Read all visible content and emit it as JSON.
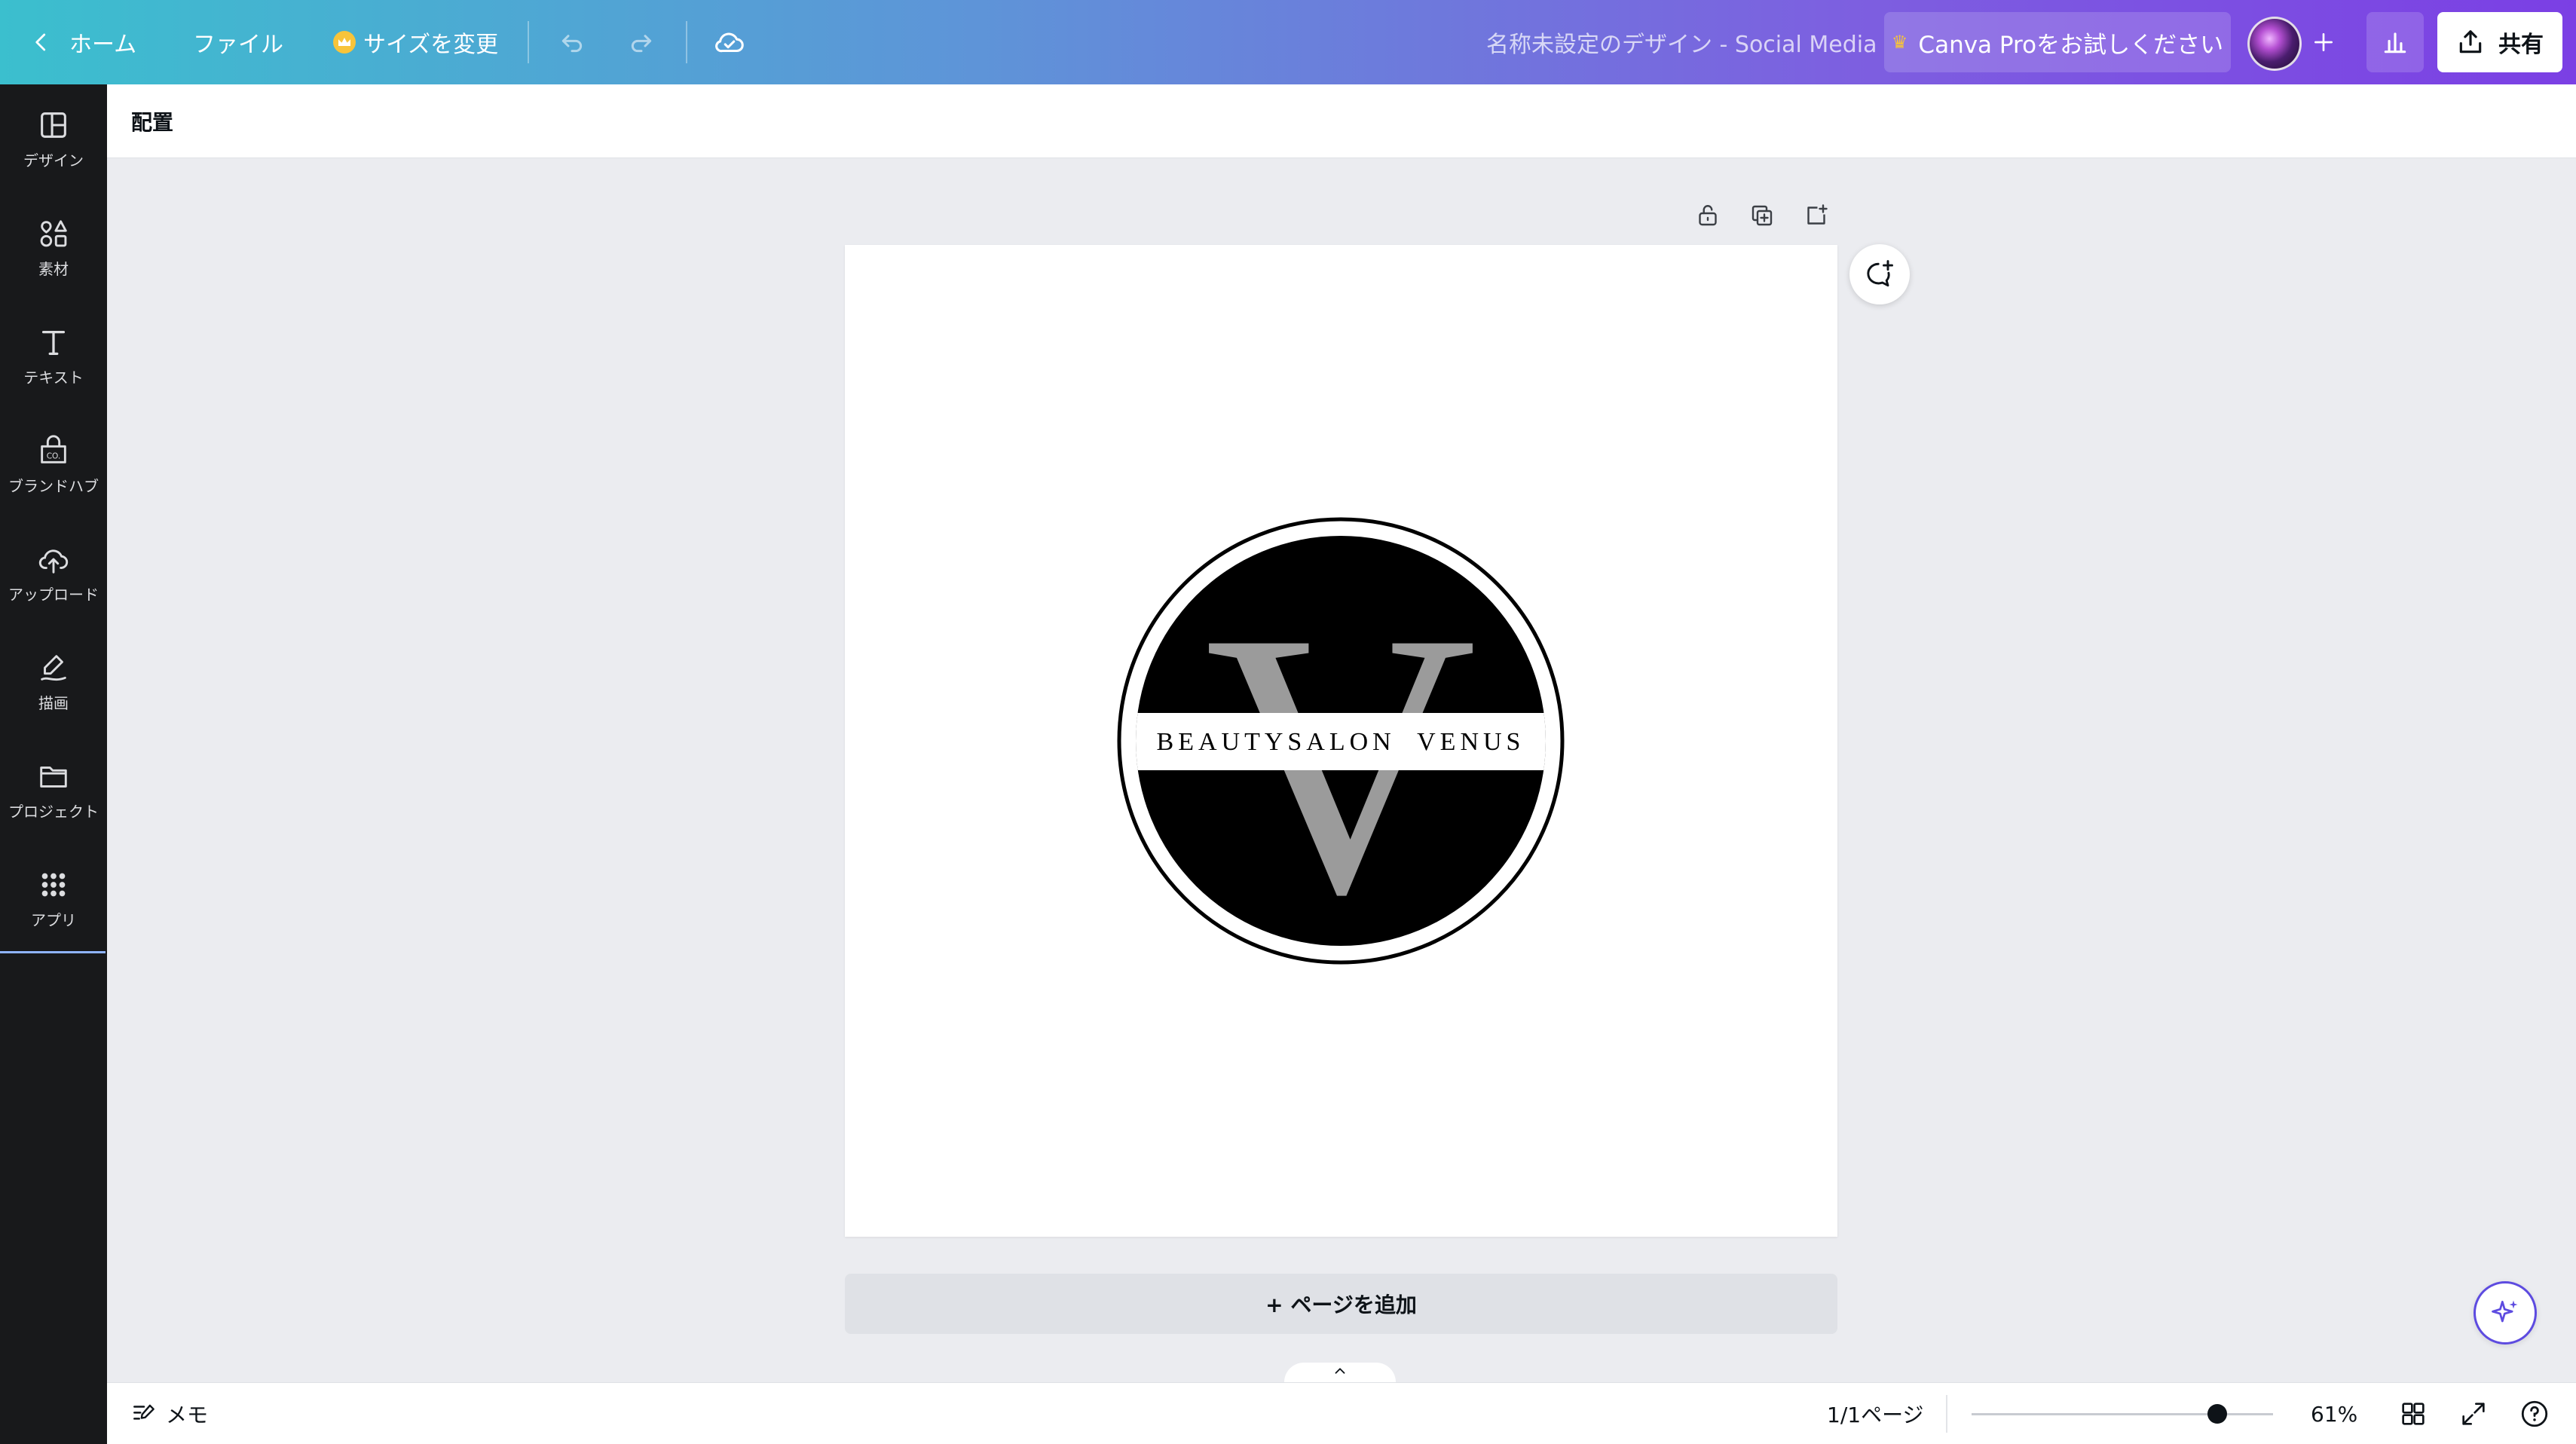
{
  "topbar": {
    "home_label": "ホーム",
    "file_label": "ファイル",
    "resize_label": "サイズを変更",
    "doc_title": "名称未設定のデザイン - Social Media",
    "pro_label": "Canva Proをお試しください",
    "share_label": "共有"
  },
  "sidebar": {
    "items": [
      {
        "label": "デザイン",
        "icon": "layout-icon"
      },
      {
        "label": "素材",
        "icon": "elements-icon"
      },
      {
        "label": "テキスト",
        "icon": "text-icon"
      },
      {
        "label": "ブランドハブ",
        "icon": "brand-hub-icon"
      },
      {
        "label": "アップロード",
        "icon": "upload-icon"
      },
      {
        "label": "描画",
        "icon": "draw-icon"
      },
      {
        "label": "プロジェクト",
        "icon": "folder-icon"
      },
      {
        "label": "アプリ",
        "icon": "apps-icon"
      }
    ]
  },
  "context_toolbar": {
    "position_label": "配置"
  },
  "canvas": {
    "logo": {
      "monogram": "V",
      "text": "BEAUTYSALON  VENUS"
    },
    "add_page_label": "+ ページを追加"
  },
  "bottombar": {
    "notes_label": "メモ",
    "page_indicator": "1/1ページ",
    "zoom_label": "61%",
    "zoom_value": 61
  },
  "colors": {
    "gradient_start": "#3bbfce",
    "gradient_end": "#7b3fe4",
    "sidebar_bg": "#18191b",
    "canvas_bg": "#ebecf0",
    "logo_black": "#000000",
    "logo_gray": "#9b9b9b"
  }
}
